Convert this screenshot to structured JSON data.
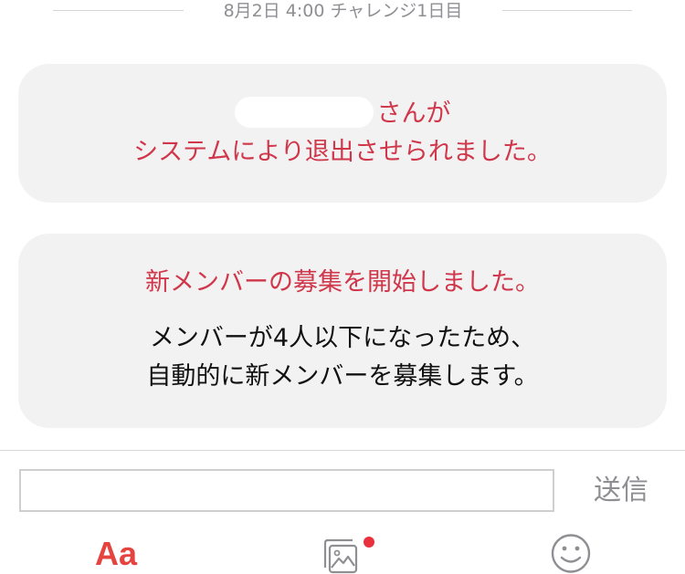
{
  "separator": {
    "date_label": "8月2日 4:00 チャレンジ1日目"
  },
  "message1": {
    "name_suffix": "さんが",
    "body": "システムにより退出させられました。"
  },
  "message2": {
    "title": "新メンバーの募集を開始しました。",
    "body_line1": "メンバーが4人以下になったため、",
    "body_line2": "自動的に新メンバーを募集します。"
  },
  "composer": {
    "input_value": "",
    "send_label": "送信"
  },
  "toolbar": {
    "text_style_label": "Aa",
    "image_icon": "image-gallery-icon",
    "notification_dot_color": "#e8313c",
    "emoji_icon": "smiley-icon"
  },
  "colors": {
    "system_red": "#d0374a",
    "accent_red": "#e5433f",
    "bubble_bg": "#f2f2f3",
    "muted_gray": "#8e8e93"
  }
}
